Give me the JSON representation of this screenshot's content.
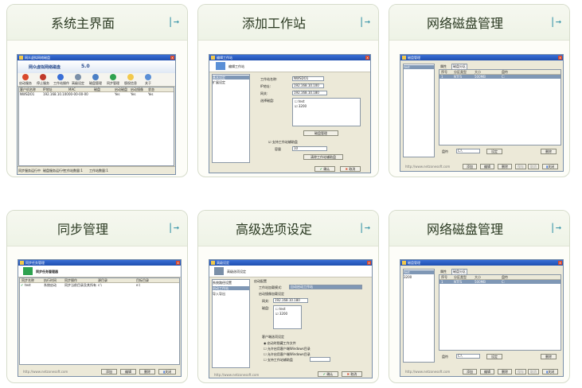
{
  "cards": [
    {
      "title": "系统主界面"
    },
    {
      "title": "添加工作站"
    },
    {
      "title": "网络磁盘管理"
    },
    {
      "title": "同步管理"
    },
    {
      "title": "高级选项设定"
    },
    {
      "title": "网络磁盘管理"
    }
  ],
  "colors": {
    "accent_arrow": "#2d8fa4",
    "title_bar": "#1f4fb0",
    "card_border": "#d6dccb"
  },
  "icons": {
    "card_arrow": "arrow-right-icon"
  },
  "arrow_glyph": "|→",
  "main": {
    "window_title": "网众虚拟网络磁盘",
    "app_name": "网众虚拟网络磁盘",
    "version": "5.0",
    "toolbar": [
      "启动服务",
      "停止服务",
      "工作站操作",
      "高级设定",
      "磁盘管理",
      "同步管理",
      "版权信息",
      "关于"
    ],
    "columns": [
      "客户机名称",
      "IP地址",
      "MAC",
      "磁盘",
      "启动磁盘",
      "启动镜像",
      "状态"
    ],
    "row": [
      "NWSDO1",
      "192.168.10.100",
      "00-00-00-00",
      "",
      "Yes",
      "Yes",
      "Yes"
    ],
    "status": [
      "同步服务运行中",
      "磁盘服务运行中",
      "工作站数量:1",
      "工作站数量:1"
    ]
  },
  "add_ws": {
    "window_title": "编辑工作站",
    "header": "编辑工作站",
    "tabs": [
      "基本设定",
      "扩展设定"
    ],
    "labels": {
      "name": "工作站名称:",
      "ip": "IP地址:",
      "gateway": "网关:",
      "disks": "选择磁盘:"
    },
    "values": {
      "name": "NWSDO1",
      "ip": "192.168.10.100",
      "gateway": "192.168.10.180"
    },
    "disk_list": [
      "test",
      "3200"
    ],
    "disk_btn": "磁盘管理",
    "check_label": "支持工作站辅助盘",
    "cap_label": "容量",
    "cap_value": "10",
    "clear_btn": "清除工作站辅助盘",
    "ok": "确认",
    "cancel": "取消"
  },
  "disk1": {
    "window_title": "磁盘管理",
    "list": [
      "test"
    ],
    "tabs": [
      "属性",
      "磁盘分区"
    ],
    "columns": [
      "序号",
      "分区类型",
      "大小",
      "盘符"
    ],
    "row": [
      "1",
      "NTFS",
      "500MB",
      "C:"
    ],
    "scan_label": "盘符",
    "scan_value": "C:\\",
    "btn_set": "设定",
    "btn_del": "删除",
    "footer_url": "http://www.netzonesoft.com",
    "btns": [
      "添加",
      "编辑",
      "删除",
      "保存",
      "取消",
      "关闭"
    ]
  },
  "sync": {
    "window_title": "同步任务管理",
    "header": "同步任务管理器",
    "columns": [
      "同步名称",
      "执行时间",
      "同步操作",
      "源目录",
      "目标目录"
    ],
    "row": [
      "test",
      "系统启动",
      "同步当前目录及其所有",
      "c:\\",
      "e:\\"
    ],
    "footer_url": "http://www.netzonesoft.com",
    "btns": [
      "添加",
      "编辑",
      "删除",
      "关闭"
    ]
  },
  "adv": {
    "window_title": "高级设定",
    "header": "高级选项设定",
    "tabs": [
      "系统路径设置",
      "启动工作站",
      "导入导出"
    ],
    "sec1": "启动配置",
    "mode_label": "工作站加载模式:",
    "mode_value": "自动启动工作站",
    "sec2": "启动镜像加载设定",
    "gw_label": "网关:",
    "gw_value": "192.168.10.180",
    "disk_label": "磁盘:",
    "disk_list": [
      "test",
      "3200"
    ],
    "sec3": "客户端选项设定",
    "opts": [
      "启动时隐藏工作文件",
      "允许启用客户端Windows目录",
      "允许启用客户端Windows目录",
      "支持工作站辅助盘"
    ],
    "footer_url": "http://www.netzonesoft.com",
    "ok": "确认",
    "cancel": "取消"
  },
  "disk2": {
    "window_title": "磁盘管理",
    "list": [
      "test",
      "3200"
    ],
    "tabs": [
      "属性",
      "磁盘分区"
    ],
    "columns": [
      "序号",
      "分区类型",
      "大小",
      "盘符"
    ],
    "row": [
      "1",
      "NTFS",
      "500MB",
      "C:"
    ],
    "scan_label": "盘符",
    "scan_value": "C:\\",
    "btn_set": "设定",
    "btn_del": "删除",
    "footer_url": "http://www.netzonesoft.com",
    "btns": [
      "添加",
      "编辑",
      "删除",
      "保存",
      "取消",
      "关闭"
    ]
  }
}
